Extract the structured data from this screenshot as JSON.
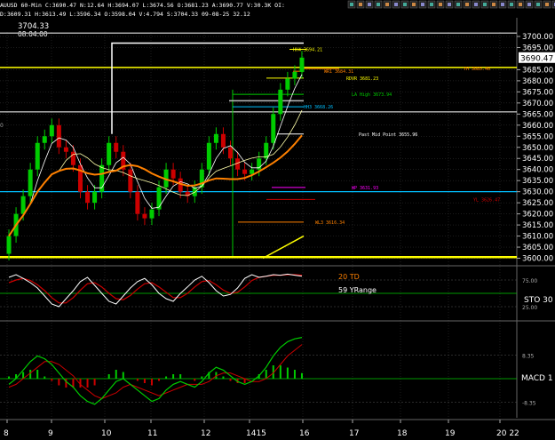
{
  "header": {
    "symbol_line": "AUUSD 60-Min C:3690.47 N:12.64 H:3694.07 L:3674.56 O:3681.23 A:3690.77 V:30.3K OI:",
    "prev_line": "D:3609.31 H:3613.49 L:3596.34 O:3598.04 V:4.794 S:3704.33 09-08-25 32.12",
    "price_label": "3704.33",
    "time_label": "08:04:00",
    "left_label": "0"
  },
  "toolbar": {
    "icons": [
      "select-arrow-icon",
      "cut-icon",
      "copy-icon",
      "chart-icon",
      "print-icon",
      "search-icon",
      "data-icon",
      "grid-icon",
      "refresh-icon",
      "zoom-icon",
      "help-icon",
      "settings-icon",
      "window-icon",
      "layout-icon",
      "arrow-up-icon",
      "arrow-down-icon",
      "line-icon",
      "sound-icon",
      "lock-icon",
      "expand-icon",
      "tile-icon",
      "minimize-icon",
      "maximize-icon",
      "close-icon"
    ]
  },
  "colors": {
    "background": "#000000",
    "grid": "#3a3a3a",
    "bull": "#00cc00",
    "bear": "#cc0000",
    "yellow": "#ffff00",
    "orange": "#ff8000",
    "white": "#ffffff",
    "green_line": "#00cc00",
    "cyan": "#00bfff",
    "magenta": "#ff00ff",
    "last_price_bg": "#ffffff"
  },
  "price_axis": {
    "ticks": [
      "3700.00",
      "3695.00",
      "3690.47",
      "3685.00",
      "3680.00",
      "3675.00",
      "3670.00",
      "3665.00",
      "3660.00",
      "3655.00",
      "3650.00",
      "3645.00",
      "3640.00",
      "3635.00",
      "3630.00",
      "3625.00",
      "3620.00",
      "3615.00",
      "3610.00",
      "3605.00",
      "3600.00"
    ],
    "last_price": "3690.47"
  },
  "levels": [
    {
      "label": "HH4 3694.21",
      "color": "#ffff00"
    },
    {
      "label": "WR1 3684.31",
      "color": "#ff8000"
    },
    {
      "label": "YH 3685.46",
      "color": "#ff8000"
    },
    {
      "label": "RDVR 3681.23",
      "color": "#ffff00"
    },
    {
      "label": "LA High 3673.94",
      "color": "#00cc00"
    },
    {
      "label": "HH3 3668.26",
      "color": "#00bfff"
    },
    {
      "label": "Past Mid Point 3655.96",
      "color": "#ffffff"
    },
    {
      "label": "WP 3631.93",
      "color": "#ff00ff"
    },
    {
      "label": "YL 3626.47",
      "color": "#cc0000"
    },
    {
      "label": "WL3 3616.34",
      "color": "#ff8000"
    }
  ],
  "indicators": {
    "td_label": "20 TD",
    "yrange_label": "59 YRange",
    "sto_label": "STO 30",
    "sto_ticks": [
      "75.00",
      "25.00"
    ],
    "macd_label": "MACD 1",
    "macd_ticks": [
      "8.35",
      "-8.35"
    ]
  },
  "time_axis": {
    "labels": [
      "8",
      "9",
      "10",
      "11",
      "12",
      "1415",
      "16",
      "17",
      "18",
      "19",
      "20 22"
    ]
  },
  "chart_data": {
    "type": "line",
    "title": "",
    "ylim": [
      3597,
      3702
    ],
    "x_labels": [
      "8",
      "9",
      "10",
      "11",
      "12",
      "14",
      "15",
      "16",
      "17",
      "18",
      "19",
      "20",
      "22"
    ],
    "price_series": {
      "open": [
        3602,
        3610,
        3620,
        3628,
        3640,
        3652,
        3655,
        3660,
        3650,
        3648,
        3642,
        3630,
        3625,
        3630,
        3642,
        3652,
        3648,
        3640,
        3630,
        3620,
        3618,
        3622,
        3632,
        3640,
        3636,
        3630,
        3628,
        3632,
        3640,
        3652,
        3656,
        3650,
        3645,
        3640,
        3638,
        3640,
        3645,
        3652,
        3665,
        3676,
        3681,
        3684
      ],
      "close": [
        3610,
        3620,
        3628,
        3640,
        3652,
        3655,
        3660,
        3650,
        3648,
        3642,
        3630,
        3625,
        3630,
        3642,
        3652,
        3648,
        3640,
        3630,
        3620,
        3618,
        3622,
        3632,
        3640,
        3636,
        3630,
        3628,
        3632,
        3640,
        3652,
        3656,
        3650,
        3645,
        3640,
        3638,
        3640,
        3645,
        3652,
        3665,
        3676,
        3681,
        3684,
        3690.47
      ]
    },
    "sto_values": [
      80,
      85,
      78,
      70,
      60,
      45,
      30,
      25,
      40,
      55,
      72,
      80,
      65,
      50,
      35,
      30,
      45,
      60,
      72,
      78,
      66,
      50,
      40,
      35,
      50,
      62,
      75,
      82,
      70,
      55,
      45,
      48,
      60,
      78,
      85,
      80,
      82,
      85,
      84,
      86,
      84,
      82
    ],
    "sto_signal": [
      70,
      75,
      78,
      74,
      66,
      55,
      42,
      32,
      32,
      42,
      56,
      68,
      70,
      62,
      50,
      40,
      38,
      46,
      58,
      68,
      70,
      62,
      52,
      42,
      42,
      50,
      62,
      72,
      74,
      66,
      56,
      50,
      52,
      62,
      74,
      80,
      82,
      84,
      84,
      85,
      85,
      84
    ],
    "macd_values": [
      -2,
      0,
      3,
      6,
      8,
      7,
      5,
      2,
      -1,
      -3,
      -6,
      -8,
      -9,
      -7,
      -4,
      -1,
      0,
      -2,
      -4,
      -6,
      -8,
      -7,
      -4,
      -2,
      -1,
      -2,
      -3,
      -1,
      2,
      4,
      3,
      1,
      -1,
      -2,
      -1,
      1,
      4,
      8,
      11,
      13,
      14,
      14.5
    ],
    "macd_signal": [
      -3,
      -2,
      0,
      2,
      4,
      6,
      6,
      5,
      3,
      1,
      -2,
      -4,
      -6,
      -7,
      -6,
      -5,
      -3,
      -2,
      -3,
      -4,
      -5,
      -6,
      -5,
      -4,
      -3,
      -2,
      -2,
      -2,
      -1,
      1,
      2,
      2,
      1,
      0,
      -1,
      -1,
      0,
      2,
      5,
      8,
      10,
      12
    ]
  }
}
